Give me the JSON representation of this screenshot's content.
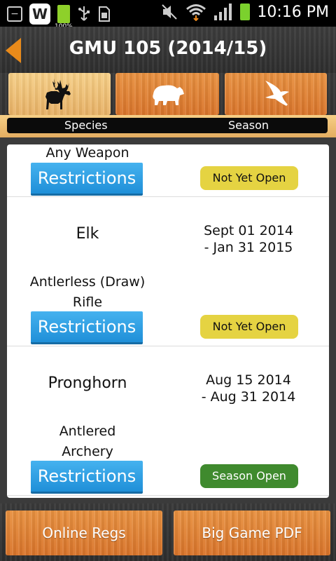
{
  "status": {
    "battery_small": "100%",
    "time": "10:16 PM"
  },
  "header": {
    "title": "GMU 105 (2014/15)"
  },
  "tabs": {
    "species_label": "Species",
    "season_label": "Season"
  },
  "entries": [
    {
      "hunt": "Any Weapon",
      "restrictions_label": "Restrictions",
      "status": "Not Yet Open"
    },
    {
      "species": "Elk",
      "dates": "Sept 01 2014\n- Jan 31 2015",
      "hunt": "Antlerless (Draw)\nRifle",
      "restrictions_label": "Restrictions",
      "status": "Not Yet Open"
    },
    {
      "species": "Pronghorn",
      "dates": "Aug 15 2014\n- Aug 31 2014",
      "hunt": "Antlered\nArchery",
      "restrictions_label": "Restrictions",
      "status": "Season Open"
    }
  ],
  "bottom": {
    "online_regs_label": "Online Regs",
    "big_game_pdf_label": "Big Game PDF"
  },
  "colors": {
    "not_yet_open": "#e5d342",
    "season_open": "#3f8a2e",
    "restrictions": "#2b9be3",
    "wood": "#d9742a"
  }
}
